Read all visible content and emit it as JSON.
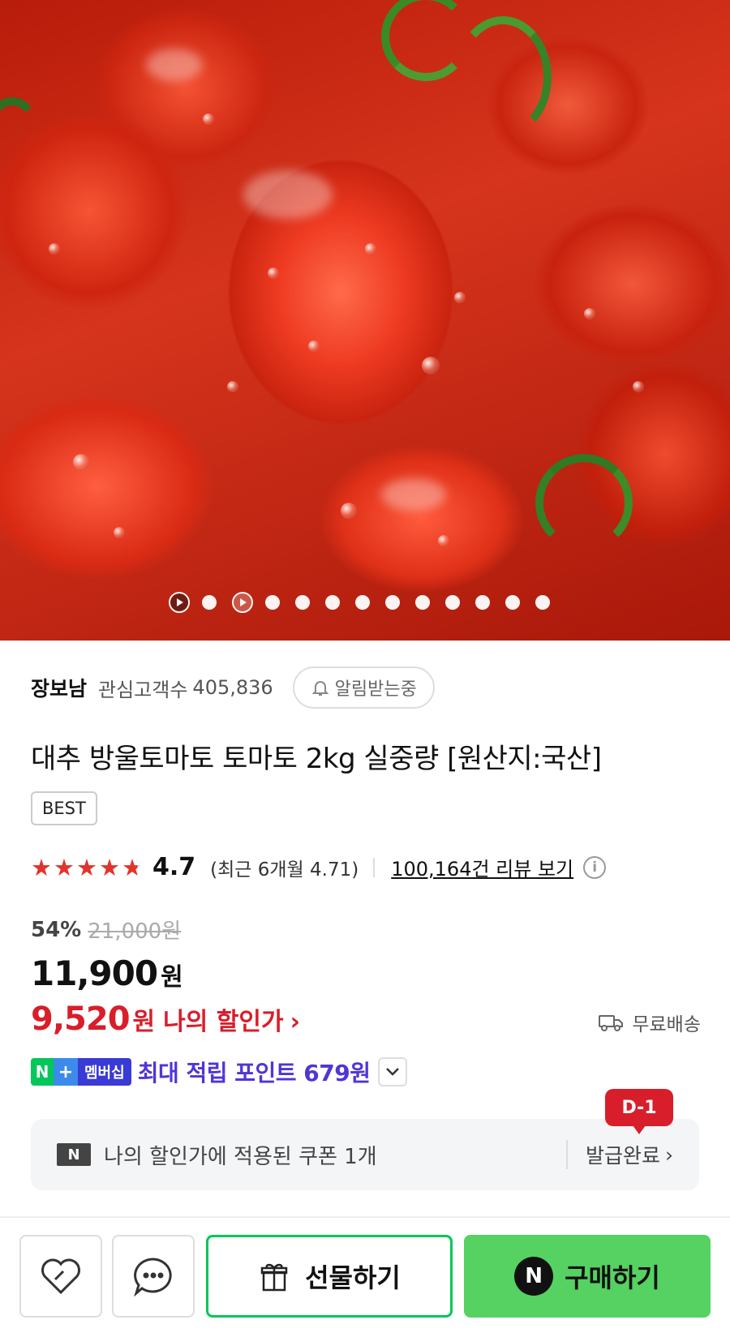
{
  "hero": {
    "image_alt": "cherry tomatoes",
    "carousel_dots": 14
  },
  "store": {
    "name": "장보남",
    "followers_label": "관심고객수",
    "followers_count": "405,836",
    "alarm_label": "알림받는중"
  },
  "product": {
    "title": "대추 방울토마토 토마토 2kg 실중량 [원산지:국산]",
    "badge": "BEST",
    "rating": "4.7",
    "rating_stars": 4.7,
    "recent_rating": "(최근 6개월 4.71)",
    "review_link": "100,164건 리뷰 보기",
    "discount_pct": "54%",
    "original_price": "21,000원",
    "price": "11,900",
    "price_unit": "원",
    "my_price": "9,520",
    "my_price_unit": "원",
    "my_price_label": "나의 할인가",
    "shipping": "무료배송"
  },
  "membership": {
    "n": "N",
    "plus": "+",
    "label": "멤버십",
    "points_text": "최대 적립 포인트 679원"
  },
  "coupon": {
    "icon": "N",
    "text": "나의 할인가에 적용된 쿠폰 1개",
    "status": "발급완료",
    "deadline_badge": "D-1"
  },
  "actions": {
    "gift_label": "선물하기",
    "buy_label": "구매하기",
    "buy_icon": "N"
  },
  "colors": {
    "accent_red": "#d81e2a",
    "naver_green": "#03c75a",
    "buy_green": "#55d262",
    "points_purple": "#4f36d6",
    "star_red": "#e0342c"
  }
}
